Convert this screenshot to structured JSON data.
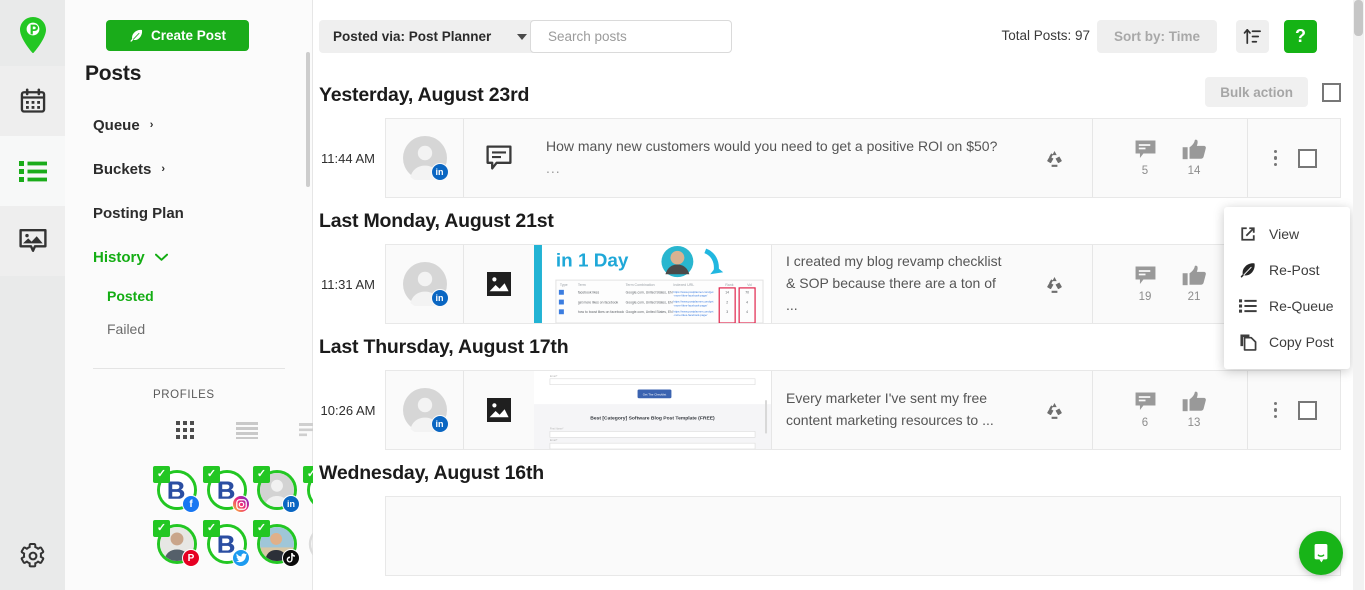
{
  "rail": {
    "items": [
      {
        "name": "logo",
        "icon": "map-pin-logo-icon"
      },
      {
        "name": "calendar",
        "icon": "calendar-icon"
      },
      {
        "name": "list",
        "icon": "list-icon"
      },
      {
        "name": "media",
        "icon": "image-icon"
      }
    ],
    "settings_icon": "gear-icon"
  },
  "sidebar": {
    "create_post_label": "Create Post",
    "heading": "Posts",
    "nav": [
      {
        "label": "Queue",
        "chevron": "›",
        "green": false
      },
      {
        "label": "Buckets",
        "chevron": "›",
        "green": false
      },
      {
        "label": "Posting Plan",
        "chevron": "",
        "green": false
      },
      {
        "label": "History",
        "chevron": "⌄",
        "green": true
      }
    ],
    "sub_items": [
      {
        "label": "Posted",
        "active": true
      },
      {
        "label": "Failed",
        "active": false
      }
    ],
    "profiles_label": "PROFILES",
    "view_toggles": [
      {
        "name": "grid-view-toggle"
      },
      {
        "name": "list-view-toggle"
      },
      {
        "name": "compact-view-toggle"
      }
    ],
    "profiles": [
      {
        "network": "facebook",
        "badge_color": "#1877f2",
        "glyph": "f",
        "avatar": "logo"
      },
      {
        "network": "instagram",
        "badge_color": "#e1306c",
        "glyph": "▢",
        "avatar": "logo"
      },
      {
        "network": "linkedin",
        "badge_color": "#0a66c2",
        "glyph": "in",
        "avatar": "person"
      },
      {
        "network": "linkedin",
        "badge_color": "#0a66c2",
        "glyph": "in",
        "avatar": "logo"
      },
      {
        "network": "pinterest",
        "badge_color": "#e60023",
        "glyph": "P",
        "avatar": "photo-man"
      },
      {
        "network": "twitter",
        "badge_color": "#1d9bf0",
        "glyph": "ᵛ",
        "avatar": "logo"
      },
      {
        "network": "tiktok",
        "badge_color": "#0b0b0b",
        "glyph": "♪",
        "avatar": "photo-beach"
      }
    ],
    "add_profile_label": "+"
  },
  "toolbar": {
    "posted_via_label": "Posted via: Post Planner",
    "search_placeholder": "Search posts",
    "search_value": "",
    "search_icon": "search-icon",
    "filter_icon": "filter-sliders-icon",
    "total_posts_label": "Total Posts: 97",
    "sort_by_label": "Sort by: Time",
    "sort_direction_icon": "sort-ascending-icon",
    "help_label": "?"
  },
  "list": {
    "bulk_action_label": "Bulk action",
    "groups": [
      {
        "title": "Yesterday, August 23rd",
        "show_bulk": true,
        "posts": [
          {
            "time": "11:44 AM",
            "network": "linkedin",
            "type_icon": "text-post-icon",
            "has_thumb": false,
            "text": "How many new customers would you need to get a positive ROI on $50?",
            "ellipsis": "...",
            "recycle_icon": "recycle-icon",
            "comments": "5",
            "likes": "14"
          }
        ]
      },
      {
        "title": "Last Monday, August 21st",
        "show_bulk": false,
        "posts": [
          {
            "time": "11:31 AM",
            "network": "linkedin",
            "type_icon": "image-post-icon",
            "has_thumb": true,
            "thumb_kind": "in-1-day-infographic",
            "thumb_heading": "in 1 Day",
            "text": "I created my blog revamp checklist & SOP because there are a ton of ...",
            "ellipsis": "",
            "recycle_icon": "recycle-icon",
            "comments": "19",
            "likes": "21"
          }
        ]
      },
      {
        "title": "Last Thursday, August 17th",
        "show_bulk": false,
        "posts": [
          {
            "time": "10:26 AM",
            "network": "linkedin",
            "type_icon": "image-post-icon",
            "has_thumb": true,
            "thumb_kind": "blog-template-screenshot",
            "thumb_heading": "Best [Category] Software Blog Post Template (FREE)",
            "thumb_button": "Get The Checklist",
            "text": "Every marketer I've sent my free content marketing resources to ...",
            "ellipsis": "",
            "recycle_icon": "recycle-icon",
            "comments": "6",
            "likes": "13"
          }
        ]
      },
      {
        "title": "Wednesday, August 16th",
        "show_bulk": false,
        "posts": []
      }
    ]
  },
  "context_menu": {
    "items": [
      {
        "label": "View",
        "icon": "external-link-icon"
      },
      {
        "label": "Re-Post",
        "icon": "feather-icon"
      },
      {
        "label": "Re-Queue",
        "icon": "list-icon"
      },
      {
        "label": "Copy Post",
        "icon": "copy-icon"
      }
    ]
  },
  "intercom": {
    "icon": "chat-bubble-icon"
  },
  "colors": {
    "brand_green": "#1aac1a",
    "accent_green": "#23c723",
    "text_dark": "#1d1d1d",
    "muted": "#8d8d8d"
  }
}
